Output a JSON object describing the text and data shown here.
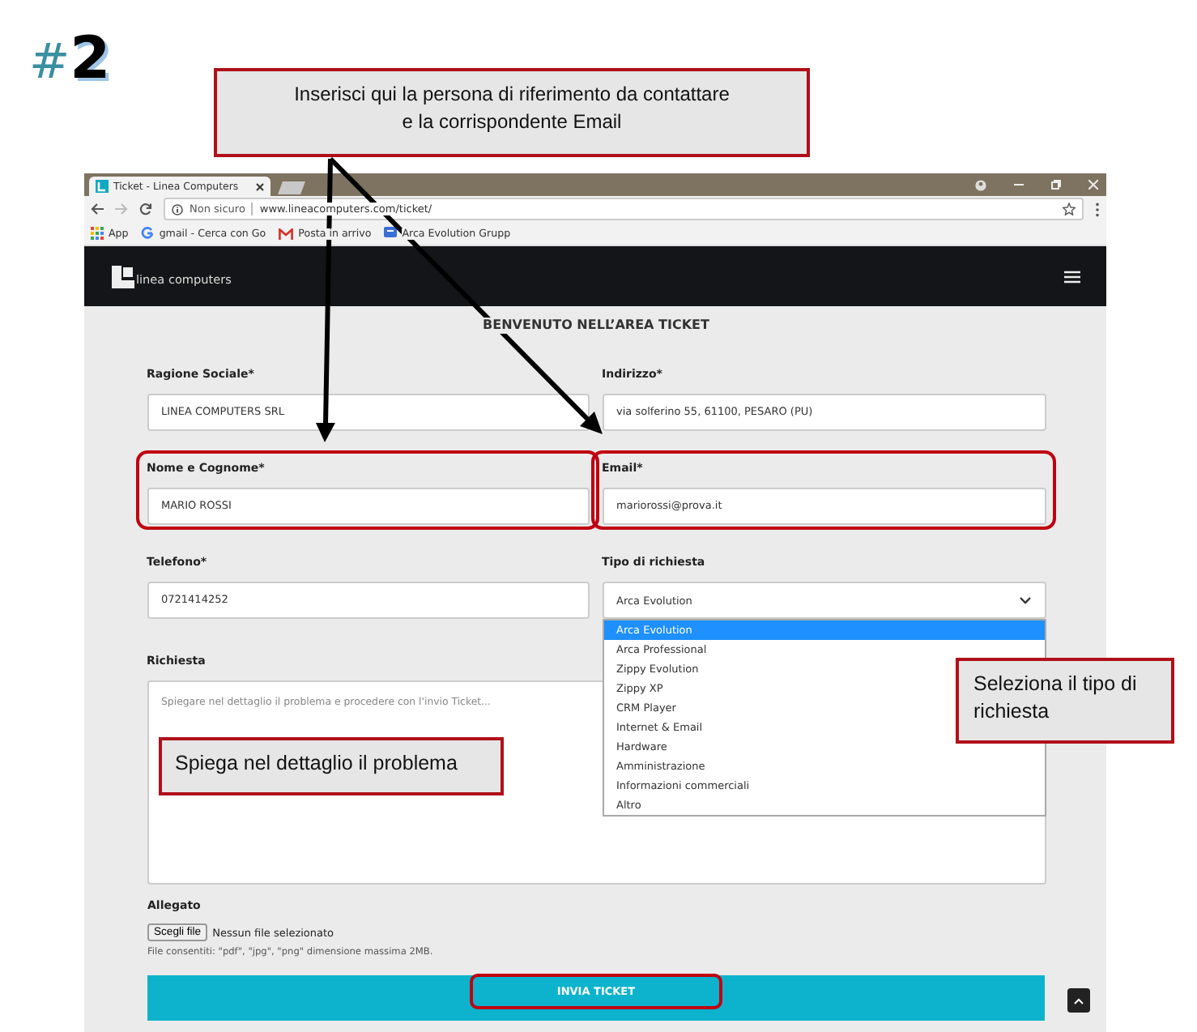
{
  "step": {
    "mark": "#",
    "number": "2"
  },
  "callouts": [
    {
      "text": "Inserisci qui la persona di riferimento da contattare\ne la corrispondente Email"
    },
    {
      "text": "Spiega nel dettaglio il problema"
    },
    {
      "text": "Seleziona il tipo di richiesta"
    }
  ],
  "browser": {
    "tab_title": "Ticket - Linea Computers",
    "security": "Non sicuro",
    "url": "www.lineacomputers.com/ticket/",
    "bookmarks": [
      {
        "label": "App",
        "kind": "apps"
      },
      {
        "label": "gmail - Cerca con Go",
        "kind": "google"
      },
      {
        "label": "Posta in arrivo",
        "kind": "mail"
      },
      {
        "label": "Arca Evolution Grupp",
        "kind": "chat"
      }
    ]
  },
  "site": {
    "logo_text": "linea computers"
  },
  "form": {
    "title": "BENVENUTO NELL’AREA TICKET",
    "fields": [
      {
        "kind": "text",
        "label": "Ragione Sociale*",
        "value": "LINEA COMPUTERS SRL",
        "highlighted": false
      },
      {
        "kind": "text",
        "label": "Indirizzo*",
        "value": "via solferino 55, 61100, PESARO (PU)",
        "highlighted": false
      },
      {
        "kind": "text",
        "label": "Nome e Cognome*",
        "value": "MARIO ROSSI",
        "highlighted": true
      },
      {
        "kind": "text",
        "label": "Email*",
        "value": "mariorossi@prova.it",
        "highlighted": true
      },
      {
        "kind": "text",
        "label": "Telefono*",
        "value": "0721414252",
        "highlighted": false
      },
      {
        "kind": "select",
        "label": "Tipo di richiesta",
        "value": "Arca Evolution",
        "highlighted": false,
        "options": [
          {
            "label": "Arca Evolution",
            "selected": true
          },
          {
            "label": "Arca Professional",
            "selected": false
          },
          {
            "label": "Zippy Evolution",
            "selected": false
          },
          {
            "label": "Zippy XP",
            "selected": false
          },
          {
            "label": "CRM Player",
            "selected": false
          },
          {
            "label": "Internet & Email",
            "selected": false
          },
          {
            "label": "Hardware",
            "selected": false
          },
          {
            "label": "Amministrazione",
            "selected": false
          },
          {
            "label": "Informazioni commerciali",
            "selected": false
          },
          {
            "label": "Altro",
            "selected": false
          }
        ]
      }
    ],
    "request": {
      "kind": "textarea",
      "label": "Richiesta",
      "placeholder": "Spiegare nel dettaglio il problema e procedere con l'invio Ticket...",
      "highlighted": false
    },
    "attachment": {
      "label": "Allegato",
      "button": "Scegli file",
      "status": "Nessun file selezionato",
      "hint": "File consentiti: \"pdf\", \"jpg\", \"png\" dimensione massima 2MB."
    },
    "submit": {
      "label": "INVIA TICKET",
      "highlighted": true
    }
  }
}
